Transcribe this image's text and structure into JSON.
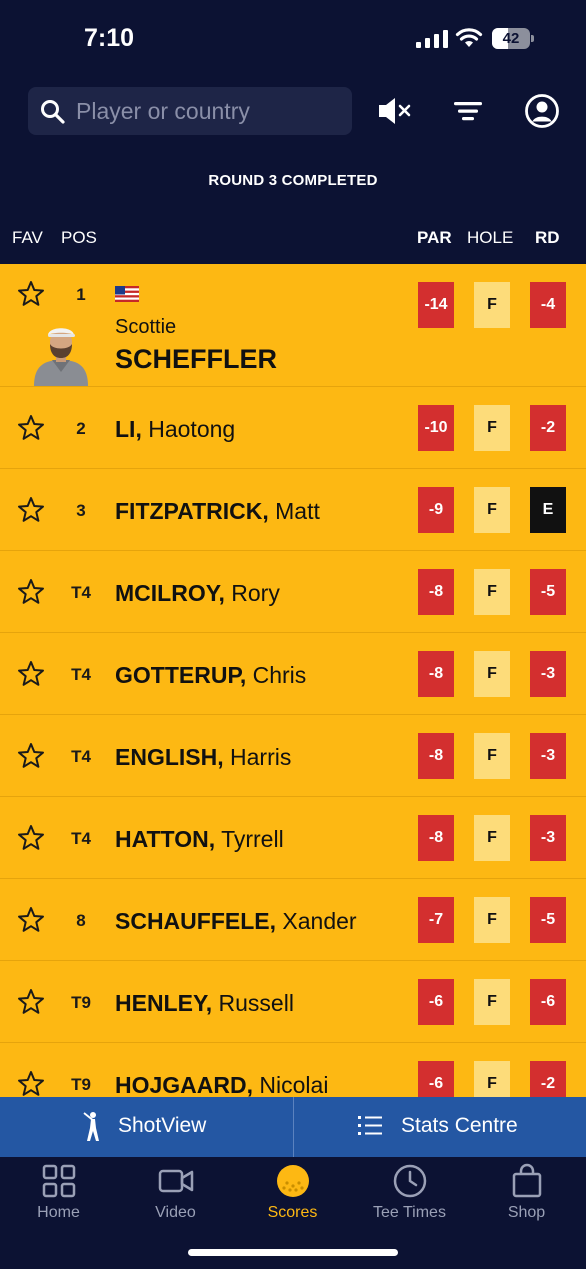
{
  "status_bar": {
    "time": "7:10",
    "battery": "42"
  },
  "search": {
    "placeholder": "Player or country"
  },
  "header": {
    "mute_icon": "speaker-muted-icon",
    "filter_icon": "filter-icon",
    "account_icon": "account-icon"
  },
  "round_status": "ROUND 3 COMPLETED",
  "columns": {
    "fav": "FAV",
    "pos": "POS",
    "par": "PAR",
    "hole": "HOLE",
    "rd": "RD"
  },
  "leader": {
    "pos": "1",
    "country": "USA",
    "first_name": "Scottie",
    "last_name": "SCHEFFLER",
    "par": "-14",
    "hole": "F",
    "rd": "-4"
  },
  "players": [
    {
      "pos": "2",
      "last": "LI,",
      "first": "Haotong",
      "par": "-10",
      "hole": "F",
      "rd": "-2"
    },
    {
      "pos": "3",
      "last": "FITZPATRICK,",
      "first": "Matt",
      "par": "-9",
      "hole": "F",
      "rd": "E"
    },
    {
      "pos": "T4",
      "last": "MCILROY,",
      "first": "Rory",
      "par": "-8",
      "hole": "F",
      "rd": "-5"
    },
    {
      "pos": "T4",
      "last": "GOTTERUP,",
      "first": "Chris",
      "par": "-8",
      "hole": "F",
      "rd": "-3"
    },
    {
      "pos": "T4",
      "last": "ENGLISH,",
      "first": "Harris",
      "par": "-8",
      "hole": "F",
      "rd": "-3"
    },
    {
      "pos": "T4",
      "last": "HATTON,",
      "first": "Tyrrell",
      "par": "-8",
      "hole": "F",
      "rd": "-3"
    },
    {
      "pos": "8",
      "last": "SCHAUFFELE,",
      "first": "Xander",
      "par": "-7",
      "hole": "F",
      "rd": "-5"
    },
    {
      "pos": "T9",
      "last": "HENLEY,",
      "first": "Russell",
      "par": "-6",
      "hole": "F",
      "rd": "-6"
    },
    {
      "pos": "T9",
      "last": "HOJGAARD,",
      "first": "Nicolai",
      "par": "-6",
      "hole": "F",
      "rd": "-2"
    }
  ],
  "action_bar": {
    "shotview": "ShotView",
    "stats": "Stats Centre"
  },
  "tabs": [
    {
      "label": "Home",
      "icon": "grid-icon",
      "active": false
    },
    {
      "label": "Video",
      "icon": "video-camera-icon",
      "active": false
    },
    {
      "label": "Scores",
      "icon": "golf-ball-icon",
      "active": true
    },
    {
      "label": "Tee Times",
      "icon": "clock-icon",
      "active": false
    },
    {
      "label": "Shop",
      "icon": "shopping-bag-icon",
      "active": false
    }
  ],
  "colors": {
    "navy": "#0c1233",
    "gold": "#fdb813",
    "red": "#d32f2f",
    "blue": "#2457a3"
  }
}
